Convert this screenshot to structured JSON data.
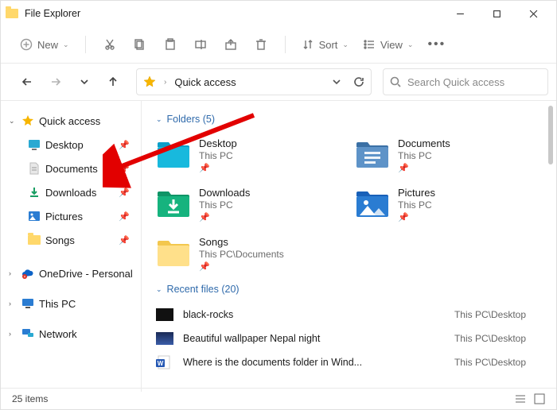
{
  "window": {
    "title": "File Explorer"
  },
  "toolbar": {
    "new_label": "New",
    "sort_label": "Sort",
    "view_label": "View"
  },
  "address": {
    "location": "Quick access"
  },
  "search": {
    "placeholder": "Search Quick access"
  },
  "sidebar": {
    "quick": {
      "label": "Quick access",
      "items": [
        {
          "label": "Desktop"
        },
        {
          "label": "Documents"
        },
        {
          "label": "Downloads"
        },
        {
          "label": "Pictures"
        },
        {
          "label": "Songs"
        }
      ]
    },
    "onedrive": {
      "label": "OneDrive - Personal"
    },
    "thispc": {
      "label": "This PC"
    },
    "network": {
      "label": "Network"
    }
  },
  "folders": {
    "header": "Folders (5)",
    "items": [
      {
        "name": "Desktop",
        "path": "This PC"
      },
      {
        "name": "Documents",
        "path": "This PC"
      },
      {
        "name": "Downloads",
        "path": "This PC"
      },
      {
        "name": "Pictures",
        "path": "This PC"
      },
      {
        "name": "Songs",
        "path": "This PC\\Documents"
      }
    ]
  },
  "recent": {
    "header": "Recent files (20)",
    "items": [
      {
        "name": "black-rocks",
        "loc": "This PC\\Desktop",
        "type": "img-dark"
      },
      {
        "name": "Beautiful wallpaper Nepal night",
        "loc": "This PC\\Desktop",
        "type": "img-blue"
      },
      {
        "name": "Where is the documents folder in Wind...",
        "loc": "This PC\\Desktop",
        "type": "word"
      }
    ]
  },
  "status": {
    "count": "25 items"
  }
}
